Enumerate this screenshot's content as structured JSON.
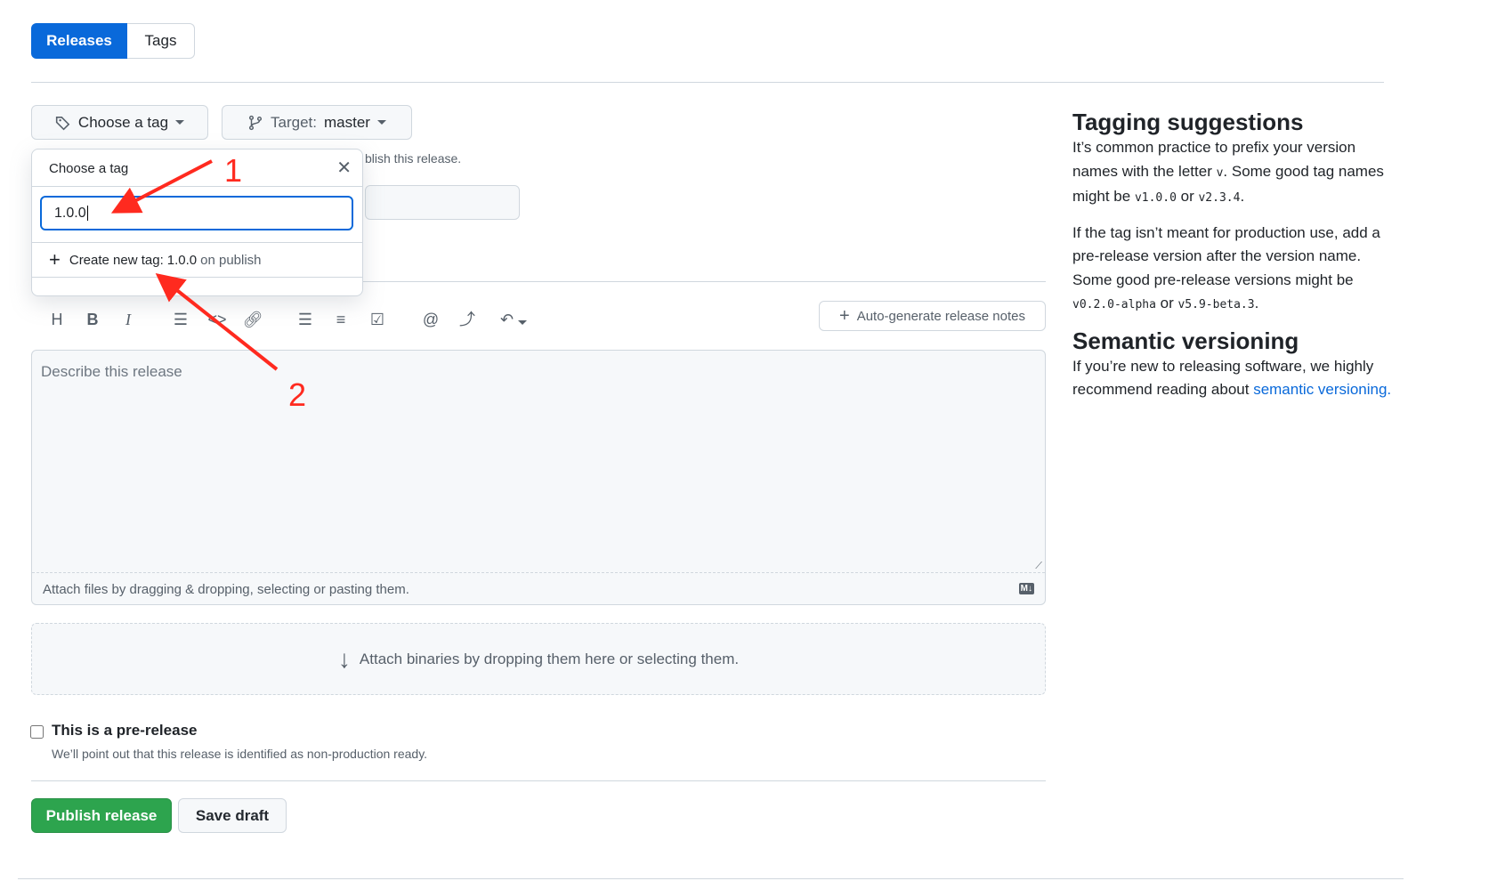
{
  "tabs": [
    {
      "label": "Releases",
      "active": true
    },
    {
      "label": "Tags",
      "active": false
    }
  ],
  "tag_button": {
    "label": "Choose a tag",
    "icon": "tag-icon"
  },
  "target_button": {
    "prefix": "Target:",
    "value": "master",
    "icon": "git-branch-icon"
  },
  "hint_text": "blish this release.",
  "tag_popup": {
    "title": "Choose a tag",
    "input_value": "1.0.0",
    "create_prefix": "Create new tag:",
    "create_tag": "1.0.0",
    "create_suffix": "on publish"
  },
  "toolbar": {
    "auto_generate": "Auto-generate release notes"
  },
  "editor": {
    "placeholder": "Describe this release",
    "attach_text": "Attach files by dragging & dropping, selecting or pasting them.",
    "md_badge": "M↓"
  },
  "binaries": {
    "text": "Attach binaries by dropping them here or selecting them."
  },
  "prerelease": {
    "label": "This is a pre-release",
    "description": "We’ll point out that this release is identified as non-production ready.",
    "checked": false
  },
  "actions": {
    "publish": "Publish release",
    "save_draft": "Save draft"
  },
  "sidebar": {
    "tagging_title": "Tagging suggestions",
    "p1a": "It’s common practice to prefix your version names with the letter ",
    "p1_v": "v",
    "p1b": ". Some good tag names might be ",
    "p1_c1": "v1.0.0",
    "p1_or": " or ",
    "p1_c2": "v2.3.4",
    "p1_end": ".",
    "p2a": "If the tag isn’t meant for production use, add a pre-release version after the version name. Some good pre-release versions might be ",
    "p2_c1": "v0.2.0-alpha",
    "p2_or": " or ",
    "p2_c2": "v5.9-beta.3",
    "p2_end": ".",
    "semver_title": "Semantic versioning",
    "p3a": "If you’re new to releasing software, we highly recommend reading about ",
    "p3_link": "semantic versioning."
  },
  "annotations": {
    "label1": "1",
    "label2": "2",
    "color": "#ff2a1f"
  },
  "colors": {
    "accent": "#0969da",
    "publish": "#2da44e"
  }
}
